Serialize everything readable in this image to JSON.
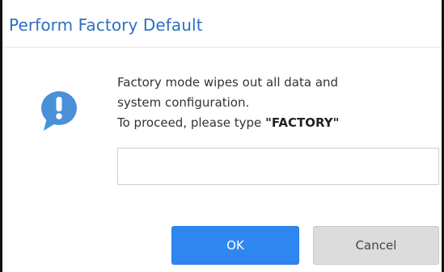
{
  "dialog": {
    "title": "Perform Factory Default",
    "icon": "exclamation-speech-bubble-icon",
    "message_line1": "Factory mode wipes out all data and",
    "message_line2": "system configuration.",
    "message_line3_prefix": "To proceed, please type ",
    "message_keyword": "\"FACTORY\"",
    "input_value": "",
    "ok_label": "OK",
    "cancel_label": "Cancel"
  },
  "colors": {
    "title": "#2e6fc0",
    "icon": "#4a90d9",
    "ok_button": "#2f86f0",
    "cancel_button": "#dcdcdc"
  }
}
